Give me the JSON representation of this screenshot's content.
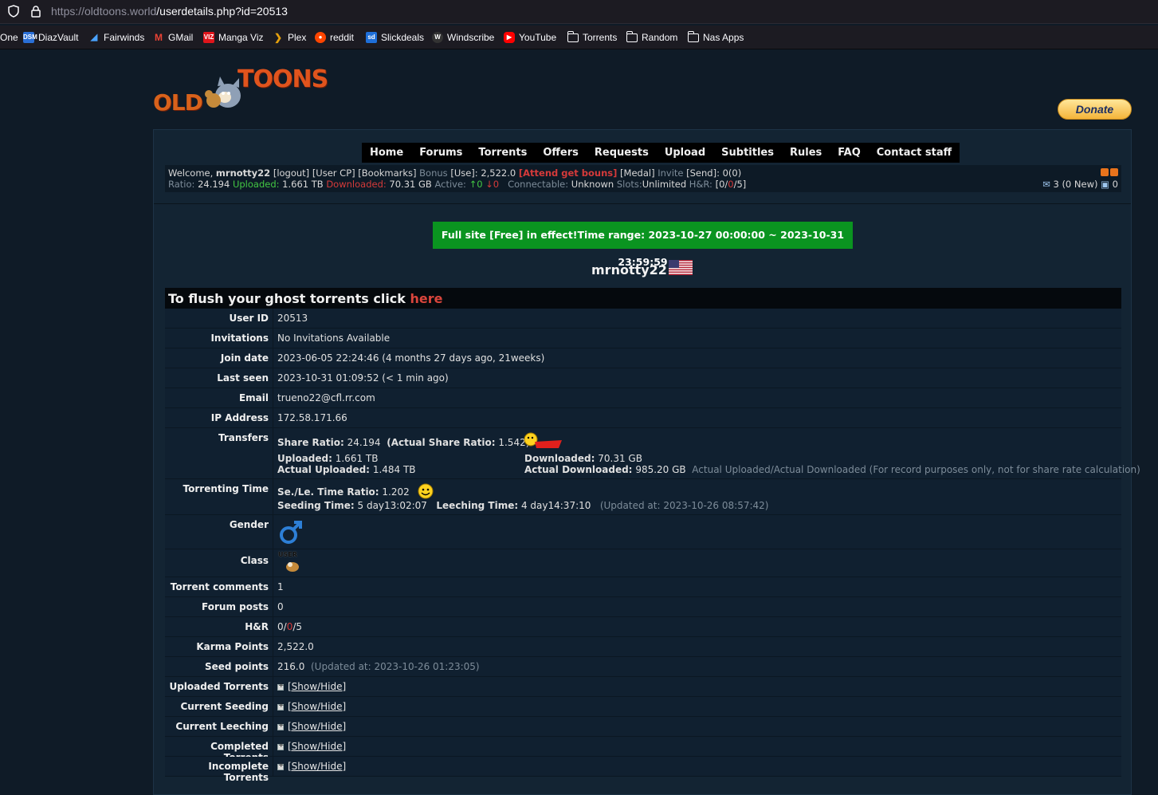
{
  "browser": {
    "url_host": "https://oldtoons.world",
    "url_path": "/userdetails.php?id=20513",
    "bookmarks": [
      "One",
      "DiazVault",
      "Fairwinds",
      "GMail",
      "Manga Viz",
      "Plex",
      "reddit",
      "Slickdeals",
      "Windscribe",
      "YouTube",
      "Torrents",
      "Random",
      "Nas Apps"
    ]
  },
  "logo": {
    "old": "OLD",
    "toons": "TOONS"
  },
  "donate_label": "Donate",
  "nav": [
    "Home",
    "Forums",
    "Torrents",
    "Offers",
    "Requests",
    "Upload",
    "Subtitles",
    "Rules",
    "FAQ",
    "Contact staff"
  ],
  "info": {
    "welcome": "Welcome,",
    "username": "mrnotty22",
    "links": "[logout] [User CP] [Bookmarks]",
    "bonus_label": "Bonus",
    "bonus_value": "[Use]: 2,522.0",
    "attend": "[Attend get bouns]",
    "medal": "[Medal]",
    "invite_label": "Invite",
    "invite_value": "[Send]: 0(0)",
    "ratio_label": "Ratio:",
    "ratio_value": "24.194",
    "uploaded_label": "Uploaded:",
    "uploaded_value": "1.661 TB",
    "downloaded_label": "Downloaded:",
    "downloaded_value": "70.31 GB",
    "active_label": "Active:",
    "active_up": "↑0",
    "active_down": "↓0",
    "connectable_label": "Connectable:",
    "connectable_value": "Unknown",
    "slots_label": "Slots:",
    "slots_value": "Unlimited",
    "hr_label": "H&R:",
    "hr_a": "[0/",
    "hr_b": "0",
    "hr_c": "/5]",
    "messages": "3 (0 New)",
    "friends": "0"
  },
  "banner": "Full site [Free] in effect!Time range: 2023-10-27 00:00:00 ~ 2023-10-31 23:59:59",
  "profile_name": "mrnotty22",
  "flush": {
    "text": "To flush your ghost torrents click ",
    "link": "here"
  },
  "rows": {
    "user_id": {
      "k": "User ID",
      "v": "20513"
    },
    "invitations": {
      "k": "Invitations",
      "v": "No Invitations Available"
    },
    "join_date": {
      "k": "Join date",
      "v": "2023-06-05 22:24:46 (4 months 27 days ago, 21weeks)"
    },
    "last_seen": {
      "k": "Last seen",
      "v": "2023-10-31 01:09:52 (< 1 min ago)"
    },
    "email": {
      "k": "Email",
      "v": "trueno22@cfl.rr.com"
    },
    "ip": {
      "k": "IP Address",
      "v": "172.58.171.66"
    },
    "transfers": {
      "k": "Transfers",
      "share_ratio_label": "Share Ratio:",
      "share_ratio_value": "24.194",
      "actual_ratio_label": "(Actual Share Ratio:",
      "actual_ratio_value": "1.542)",
      "uploaded_label": "Uploaded:",
      "uploaded_value": "1.661 TB",
      "actual_uploaded_label": "Actual Uploaded:",
      "actual_uploaded_value": "1.484 TB",
      "downloaded_label": "Downloaded:",
      "downloaded_value": "70.31 GB",
      "actual_downloaded_label": "Actual Downloaded:",
      "actual_downloaded_value": "985.20 GB",
      "note": "Actual Uploaded/Actual Downloaded (For record purposes only, not for share rate calculation)"
    },
    "torrenting_time": {
      "k": "Torrenting Time",
      "ratio_label": "Se./Le. Time Ratio:",
      "ratio_value": "1.202",
      "seeding_label": "Seeding Time:",
      "seeding_value": "5 day13:02:07",
      "leeching_label": "Leeching Time:",
      "leeching_value": "4 day14:37:10",
      "updated": "(Updated at: 2023-10-26 08:57:42)"
    },
    "gender": {
      "k": "Gender"
    },
    "class": {
      "k": "Class",
      "badge": "USER"
    },
    "torrent_comments": {
      "k": "Torrent comments",
      "v": "1"
    },
    "forum_posts": {
      "k": "Forum posts",
      "v": "0"
    },
    "hr": {
      "k": "H&R",
      "a": "0/",
      "b": "0",
      "c": "/5"
    },
    "karma": {
      "k": "Karma Points",
      "v": "2,522.0"
    },
    "seed_points": {
      "k": "Seed points",
      "v": "216.0",
      "updated": "(Updated at: 2023-10-26 01:23:05)"
    },
    "uploaded_torrents": {
      "k": "Uploaded Torrents",
      "v": "[Show/Hide]"
    },
    "current_seeding": {
      "k": "Current Seeding",
      "v": "[Show/Hide]"
    },
    "current_leeching": {
      "k": "Current Leeching",
      "v": "[Show/Hide]"
    },
    "completed_torrents": {
      "k": "Completed Torrents",
      "v": "[Show/Hide]"
    },
    "incomplete_torrents": {
      "k": "Incomplete Torrents",
      "v": "[Show/Hide]"
    }
  }
}
